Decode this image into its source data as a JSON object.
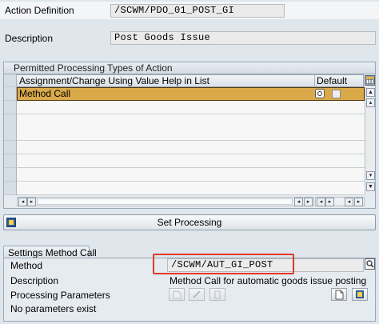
{
  "header": {
    "action_definition_label": "Action Definition",
    "action_definition_value": "/SCWM/PDO_01_POST_GI",
    "description_label": "Description",
    "description_value": "Post Goods Issue"
  },
  "permitted": {
    "title": "Permitted Processing Types of Action",
    "col_assignment": "Assignment/Change Using Value Help in List",
    "col_default": "Default",
    "rows": [
      "Method Call",
      "",
      "",
      "",
      "",
      "",
      "",
      ""
    ]
  },
  "set_processing_label": "Set Processing",
  "settings": {
    "tab_label": "Settings Method Call",
    "method_label": "Method",
    "method_value": "/SCWM/AUT_GI_POST",
    "description_label": "Description",
    "description_value": "Method Call for automatic goods issue posting",
    "params_label": "Processing Parameters",
    "no_params": "No parameters exist"
  },
  "colors": {
    "selected_row": "#d9a94a",
    "highlight_box": "#e0392b"
  }
}
